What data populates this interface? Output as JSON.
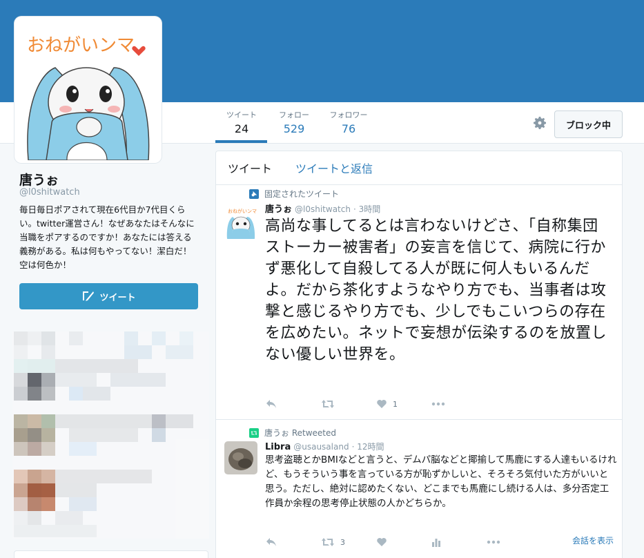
{
  "profile": {
    "name": "唐うぉ",
    "handle": "@l0shitwatch",
    "bio": "毎日毎日ポアされて現在6代目か7代目くらい。twitter運営さん！なぜあなたはそんなに当職をポアするのですか！あなたには答える義務がある。私は何もやってない！潔白だ！空は何色か！",
    "avatar_caption": "おねがいンマ",
    "tweet_button": "ツイート"
  },
  "nav": {
    "items": [
      {
        "label": "ツイート",
        "value": "24"
      },
      {
        "label": "フォロー",
        "value": "529"
      },
      {
        "label": "フォロワー",
        "value": "76"
      }
    ],
    "block_button": "ブロック中"
  },
  "timeline": {
    "tabs": [
      "ツイート",
      "ツイートと返信"
    ],
    "tweets": [
      {
        "context": "固定されたツイート",
        "name": "唐うぉ",
        "handle": "@l0shitwatch",
        "time": "· 3時間",
        "text": "高尚な事してるとは言わないけどさ、「自称集団ストーカー被害者」の妄言を信じて、病院に行かず悪化して自殺してる人が既に何人もいるんだよ。だから茶化すようなやり方でも、当事者は攻撃と感じるやり方でも、少しでもこいつらの存在を広めたい。ネットで妄想が伝染するのを放置しない優しい世界を。",
        "like_count": "1"
      },
      {
        "context": "唐うぉ Retweeted",
        "name": "Libra",
        "handle": "@usausaland",
        "time": "· 12時間",
        "text": "思考盗聴とかBMIなどと言うと、デムパ脳などと揶揄して馬鹿にする人達もいるけれど、もうそういう事を言っている方が恥ずかしいと、そろそろ気付いた方がいいと思う。ただし、絶対に認めたくない、どこまでも馬鹿にし続ける人は、多分否定工作員か余程の思考停止状態の人かどちらか。",
        "retweet_count": "3",
        "convo_link": "会話を表示"
      }
    ]
  },
  "colors": {
    "banner": "#2b7bb9",
    "accent": "#2b7bb9",
    "tweet_button": "#3397c7",
    "retweet_green": "#19cf86"
  }
}
